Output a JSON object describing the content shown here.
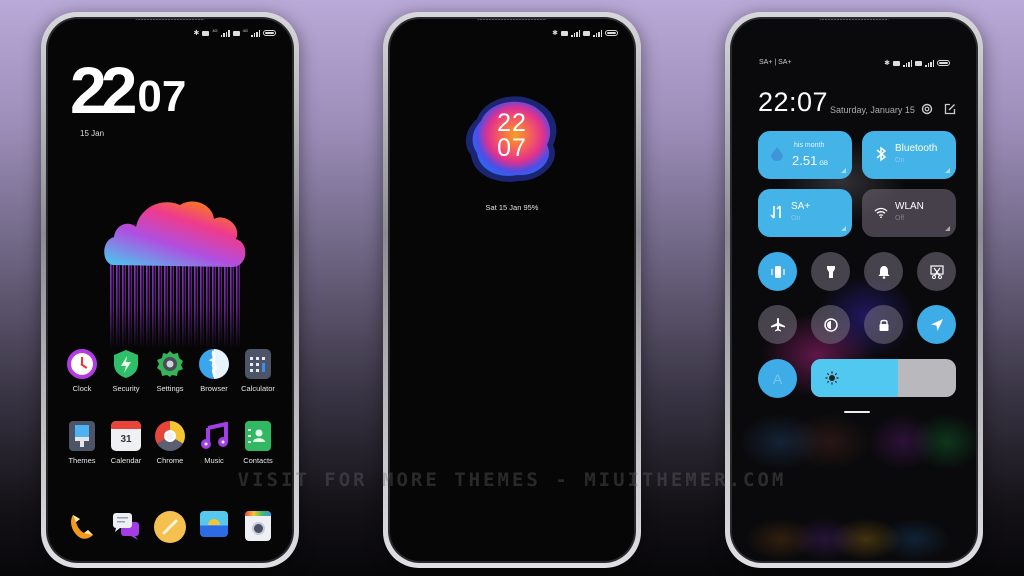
{
  "home": {
    "clock_hour": "22",
    "clock_minute": "07",
    "date": "15 Jan",
    "apps_row1": [
      {
        "label": "Clock",
        "icon": "clock-icon"
      },
      {
        "label": "Security",
        "icon": "shield-icon"
      },
      {
        "label": "Settings",
        "icon": "gear-icon"
      },
      {
        "label": "Browser",
        "icon": "globe-icon"
      },
      {
        "label": "Calculator",
        "icon": "calculator-icon"
      }
    ],
    "apps_row2": [
      {
        "label": "Themes",
        "icon": "paintbrush-icon"
      },
      {
        "label": "Calendar",
        "icon": "calendar-icon",
        "day": "31"
      },
      {
        "label": "Chrome",
        "icon": "chrome-icon"
      },
      {
        "label": "Music",
        "icon": "music-note-icon"
      },
      {
        "label": "Contacts",
        "icon": "contacts-icon"
      }
    ],
    "dock": [
      {
        "icon": "phone-icon"
      },
      {
        "icon": "messages-icon"
      },
      {
        "icon": "notes-icon"
      },
      {
        "icon": "gallery-icon"
      },
      {
        "icon": "camera-icon"
      }
    ]
  },
  "aod": {
    "hour": "22",
    "minute": "07",
    "date_battery": "Sat 15 Jan   95%"
  },
  "control_center": {
    "carrier": "SA+ | SA+",
    "time": "22:07",
    "date": "Saturday, January 15",
    "tiles": {
      "data": {
        "label": "his month",
        "value": "2.51",
        "unit": "GB"
      },
      "bluetooth": {
        "title": "Bluetooth",
        "state": "On"
      },
      "mobile": {
        "title": "SA+",
        "state": "On"
      },
      "wlan": {
        "title": "WLAN",
        "state": "Off"
      }
    },
    "toggles": [
      {
        "name": "vibrate",
        "on": true
      },
      {
        "name": "flashlight",
        "on": false
      },
      {
        "name": "ring",
        "on": false
      },
      {
        "name": "screenshot",
        "on": false
      },
      {
        "name": "airplane",
        "on": false
      },
      {
        "name": "reading-mode",
        "on": false
      },
      {
        "name": "lock",
        "on": false
      },
      {
        "name": "location",
        "on": true
      }
    ],
    "auto_brightness_label": "A",
    "brightness_percent": 60
  },
  "watermark": "VISIT FOR MORE THEMES - MIUITHEMER.COM",
  "colors": {
    "accent_blue": "#44b3e8",
    "tile_off": "#6e6978"
  }
}
